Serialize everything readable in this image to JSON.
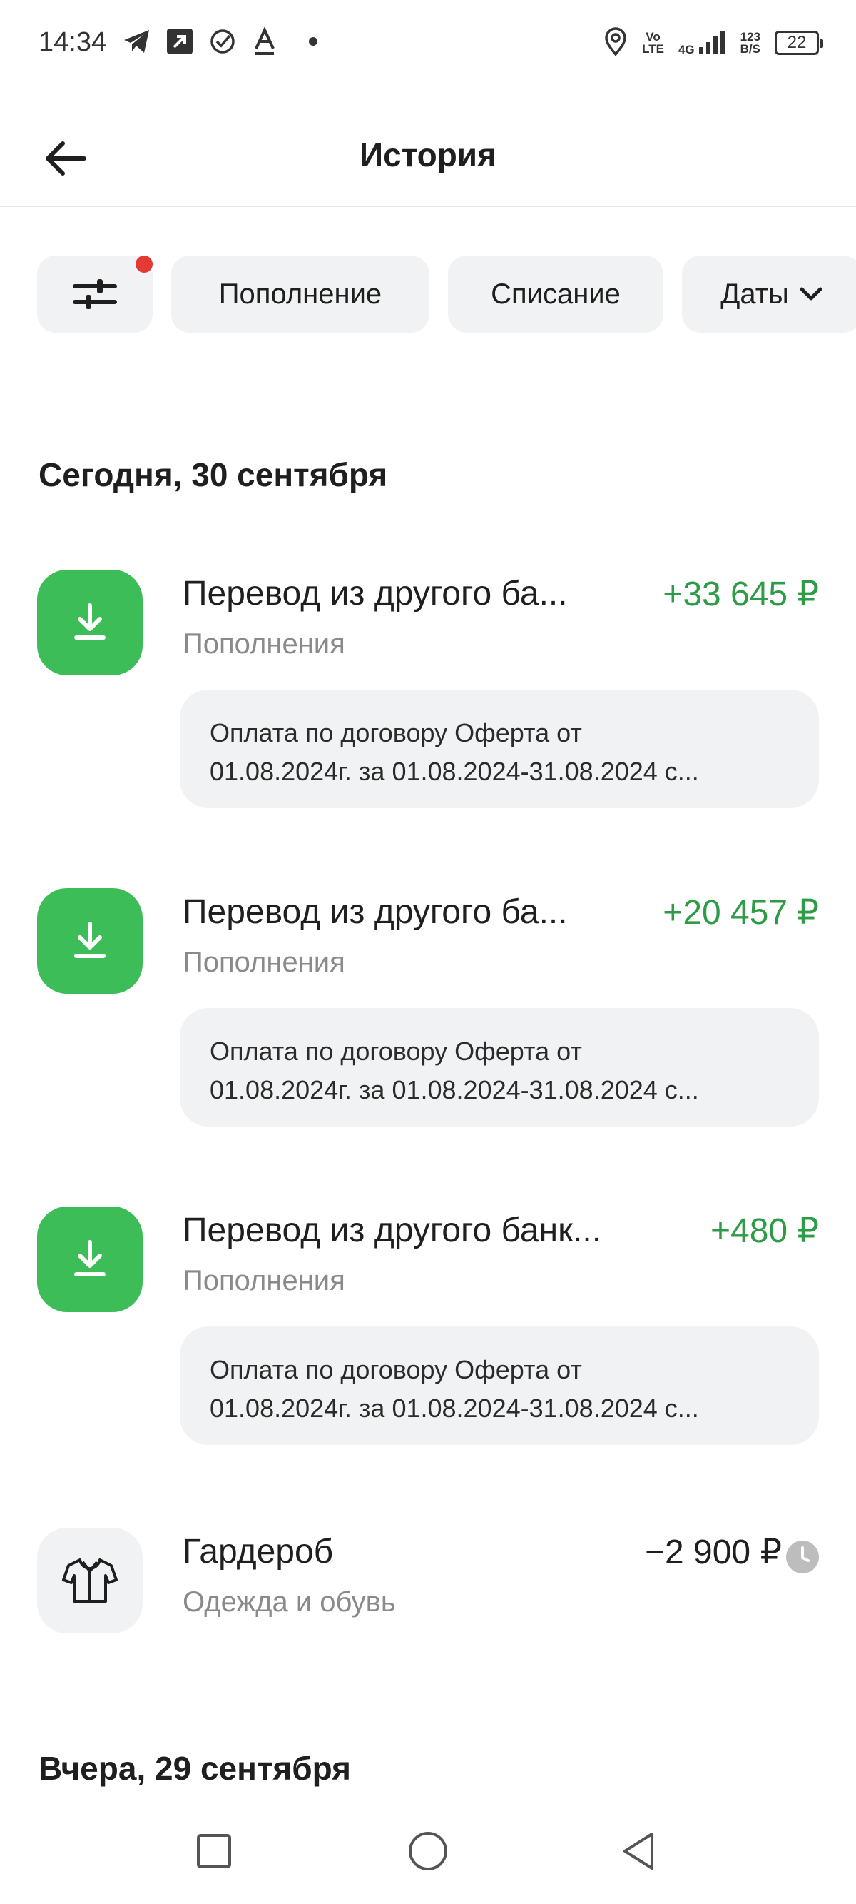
{
  "status_bar": {
    "time": "14:34",
    "net_top": "Vo",
    "net_bottom": "LTE",
    "gen": "4G",
    "speed_top": "123",
    "speed_bottom": "B/S",
    "battery": "22"
  },
  "header": {
    "title": "История"
  },
  "filters": {
    "deposit": "Пополнение",
    "withdraw": "Списание",
    "dates": "Даты"
  },
  "sections": {
    "today": "Сегодня, 30 сентября",
    "yesterday": "Вчера, 29 сентября"
  },
  "transactions": [
    {
      "name": "Перевод из другого ба...",
      "category": "Пополнения",
      "amount": "+33 645 ₽",
      "note_line1": "Оплата по договору Оферта от",
      "note_line2": "01.08.2024г. за 01.08.2024-31.08.2024 с..."
    },
    {
      "name": "Перевод из другого ба...",
      "category": "Пополнения",
      "amount": "+20 457 ₽",
      "note_line1": "Оплата по договору Оферта от",
      "note_line2": "01.08.2024г. за 01.08.2024-31.08.2024 с..."
    },
    {
      "name": "Перевод из другого банк...",
      "category": "Пополнения",
      "amount": "+480 ₽",
      "note_line1": "Оплата по договору Оферта от",
      "note_line2": "01.08.2024г. за 01.08.2024-31.08.2024 с..."
    },
    {
      "name": "Гардероб",
      "category": "Одежда и обувь",
      "amount": "−2 900 ₽"
    }
  ],
  "icons": {
    "incoming": "download-arrow-icon",
    "clothes": "shirt-icon",
    "pending": "clock-icon"
  },
  "colors": {
    "accent_green": "#3dbd57",
    "amount_green": "#2e9b47",
    "notification_dot": "#e53935"
  }
}
